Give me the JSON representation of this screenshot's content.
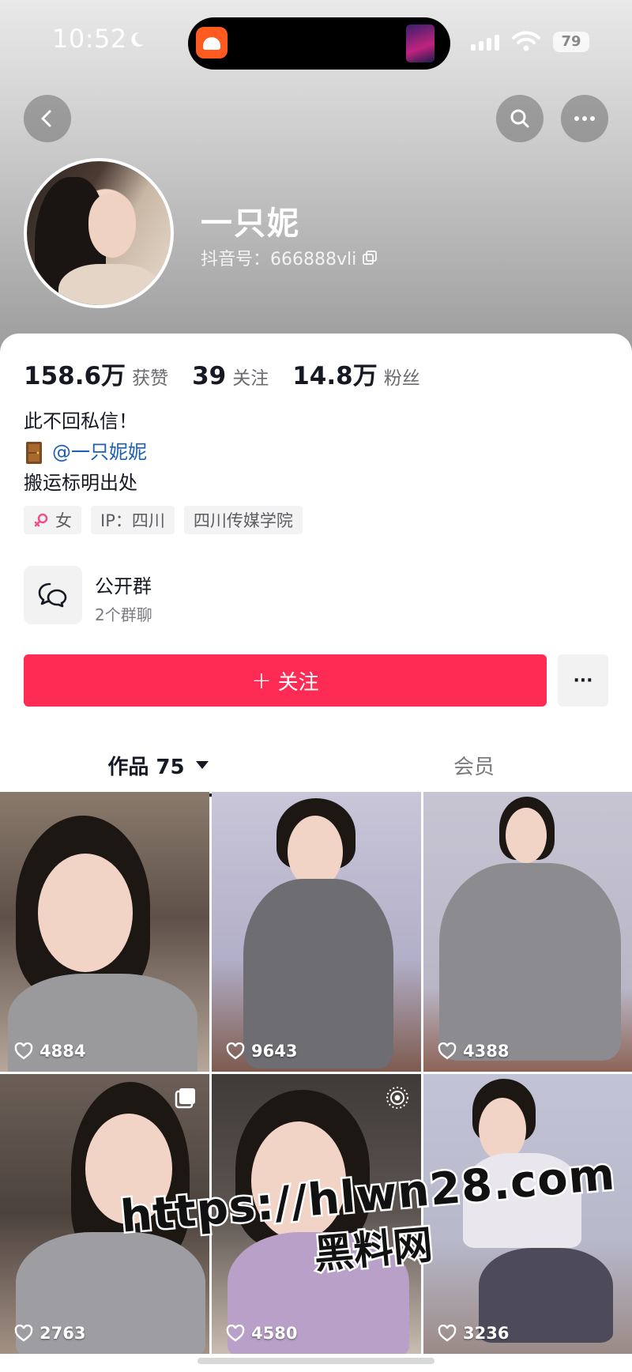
{
  "status_bar": {
    "time": "10:52",
    "battery": "79"
  },
  "profile": {
    "nickname": "一只妮",
    "douyin_id": "抖音号：666888vli"
  },
  "stats": [
    {
      "value": "158.6万",
      "label": "获赞"
    },
    {
      "value": "39",
      "label": "关注"
    },
    {
      "value": "14.8万",
      "label": "粉丝"
    }
  ],
  "bio": {
    "line1": "此不回私信！",
    "mention": "@一只妮妮",
    "line3": "搬运标明出处"
  },
  "tags": {
    "gender": "女",
    "ip": "IP：四川",
    "school": "四川传媒学院"
  },
  "group": {
    "title": "公开群",
    "subtitle": "2个群聊"
  },
  "actions": {
    "follow": "关注",
    "more": "···"
  },
  "tabs": {
    "works": "作品 75",
    "member": "会员"
  },
  "videos": [
    {
      "likes": "4884"
    },
    {
      "likes": "9643"
    },
    {
      "likes": "4388"
    },
    {
      "likes": "2763"
    },
    {
      "likes": "4580"
    },
    {
      "likes": "3236"
    }
  ],
  "watermark": {
    "url": "https://hlwn28.com",
    "name": "黑料网"
  },
  "colors": {
    "accent": "#fe2c55",
    "mention": "#1c5fb3"
  }
}
